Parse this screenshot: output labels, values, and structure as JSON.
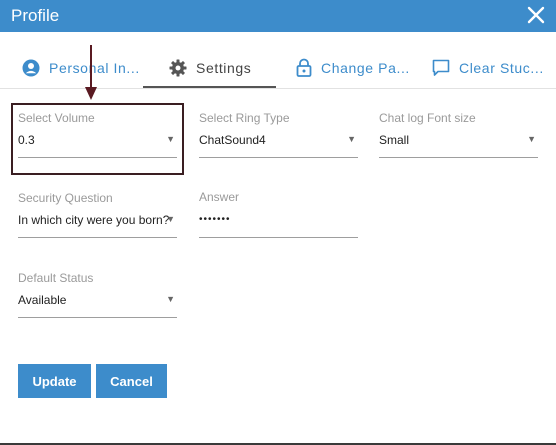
{
  "dialog": {
    "title": "Profile"
  },
  "tabs": [
    {
      "label": "Personal In...",
      "icon": "user-circle-icon",
      "active": false
    },
    {
      "label": "Settings",
      "icon": "gear-icon",
      "active": true
    },
    {
      "label": "Change Pa...",
      "icon": "lock-icon",
      "active": false
    },
    {
      "label": "Clear Stuc...",
      "icon": "chat-bubble-icon",
      "active": false
    }
  ],
  "fields": {
    "volume": {
      "label": "Select Volume",
      "value": "0.3"
    },
    "ring_type": {
      "label": "Select Ring Type",
      "value": "ChatSound4"
    },
    "font_size": {
      "label": "Chat log Font size",
      "value": "Small"
    },
    "security_question": {
      "label": "Security Question",
      "value": "In which city were you born?"
    },
    "answer": {
      "label": "Answer",
      "value": "•••••••"
    },
    "default_status": {
      "label": "Default Status",
      "value": "Available"
    }
  },
  "buttons": {
    "update": "Update",
    "cancel": "Cancel"
  },
  "colors": {
    "accent": "#3d8ccb",
    "highlight_border": "#3a1e22"
  }
}
